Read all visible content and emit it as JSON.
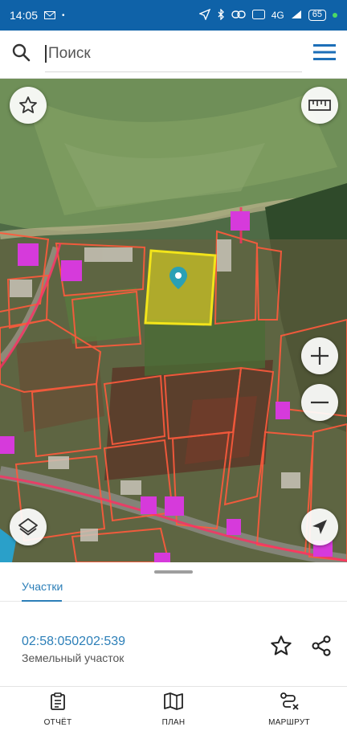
{
  "status_bar": {
    "time": "14:05",
    "network": "4G",
    "battery": "65"
  },
  "search": {
    "placeholder": "Поиск"
  },
  "icons": {
    "search": "search-icon",
    "menu": "hamburger-menu-icon",
    "favorite": "star-icon",
    "ruler": "ruler-icon",
    "zoom_in": "plus-icon",
    "zoom_out": "minus-icon",
    "layers": "layers-icon",
    "location": "navigation-arrow-icon",
    "marker": "map-marker-icon",
    "share": "share-icon",
    "report": "clipboard-icon",
    "plan": "map-icon",
    "route": "route-icon"
  },
  "colors": {
    "status_bar": "#0f62a8",
    "accent": "#2c7fb8",
    "parcel_border": "#ff5a3c",
    "selected_parcel": "#f2e41a",
    "building": "#d63adb"
  },
  "sheet": {
    "tab_label": "Участки",
    "parcel_number": "02:58:050202:539",
    "parcel_type": "Земельный участок"
  },
  "bottom_nav": {
    "report_label": "ОТЧЁТ",
    "plan_label": "ПЛАН",
    "route_label": "МАРШРУТ"
  }
}
